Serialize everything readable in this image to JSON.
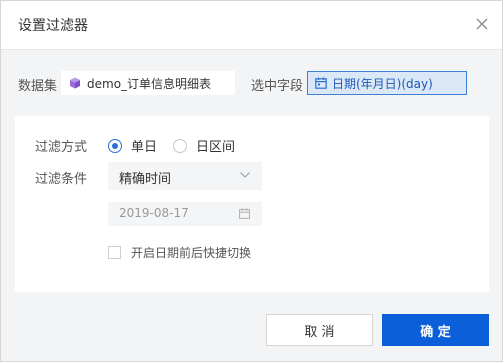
{
  "dialog": {
    "title": "设置过滤器"
  },
  "dataset": {
    "label": "数据集",
    "name": "demo_订单信息明细表"
  },
  "field": {
    "label": "选中字段",
    "name": "日期(年月日)(day)"
  },
  "filter_mode": {
    "label": "过滤方式",
    "options": [
      {
        "label": "单日",
        "selected": true
      },
      {
        "label": "日区间",
        "selected": false
      }
    ]
  },
  "filter_condition": {
    "label": "过滤条件",
    "selected": "精确时间",
    "date_value": "2019-08-17"
  },
  "quick_switch": {
    "label": "开启日期前后快捷切换",
    "checked": false
  },
  "buttons": {
    "cancel": "取 消",
    "confirm": "确 定"
  },
  "colors": {
    "primary": "#0b5fd9",
    "selected_field_bg": "#dbe8f8",
    "body_bg": "#f3f4f6"
  }
}
